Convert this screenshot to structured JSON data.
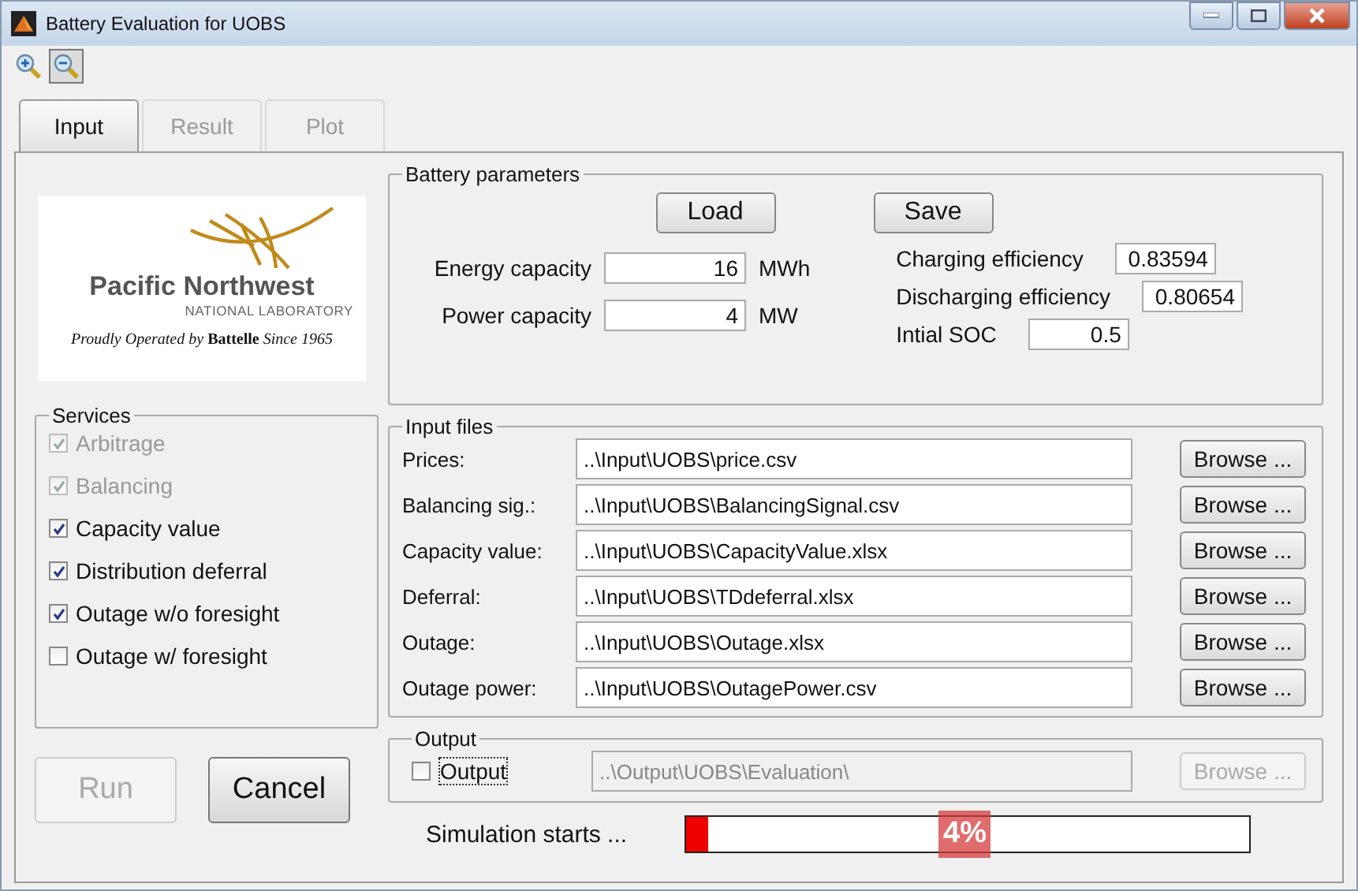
{
  "window": {
    "title": "Battery Evaluation for UOBS"
  },
  "toolbar": [
    {
      "kind": "zoom-in",
      "pressed": false
    },
    {
      "kind": "zoom-out",
      "pressed": true
    }
  ],
  "tabs": [
    {
      "label": "Input",
      "selected": true
    },
    {
      "label": "Result",
      "selected": false
    },
    {
      "label": "Plot",
      "selected": false
    }
  ],
  "logo": {
    "name": "Pacific Northwest",
    "subtitle": "NATIONAL LABORATORY",
    "tagline": "*Proudly Operated by* **Battelle** *Since 1965*"
  },
  "services": {
    "title": "Services",
    "items": [
      {
        "label": "Arbitrage",
        "checked": true,
        "disabled": true
      },
      {
        "label": "Balancing",
        "checked": true,
        "disabled": true
      },
      {
        "label": "Capacity value",
        "checked": true,
        "disabled": false
      },
      {
        "label": "Distribution deferral",
        "checked": true,
        "disabled": false
      },
      {
        "label": "Outage w/o foresight",
        "checked": true,
        "disabled": false
      },
      {
        "label": "Outage w/ foresight",
        "checked": false,
        "disabled": false
      }
    ]
  },
  "actions": [
    {
      "label": "Run",
      "disabled": true
    },
    {
      "label": "Cancel",
      "disabled": false
    }
  ],
  "battery_parameters": {
    "title": "Battery parameters",
    "buttons": [
      "Load",
      "Save"
    ],
    "left": [
      {
        "label": "Energy capacity",
        "value": "16",
        "unit": "MWh"
      },
      {
        "label": "Power capacity",
        "value": "4",
        "unit": "MW"
      }
    ],
    "right": [
      {
        "label": "Charging efficiency",
        "value": "0.83594"
      },
      {
        "label": "Discharging efficiency",
        "value": "0.80654"
      },
      {
        "label": "Intial SOC",
        "value": "0.5"
      }
    ]
  },
  "input_files": {
    "title": "Input files",
    "rows": [
      {
        "label": "Prices:",
        "path": "..\\Input\\UOBS\\price.csv",
        "button": "Browse ..."
      },
      {
        "label": "Balancing sig.:",
        "path": "..\\Input\\UOBS\\BalancingSignal.csv",
        "button": "Browse ..."
      },
      {
        "label": "Capacity value:",
        "path": "..\\Input\\UOBS\\CapacityValue.xlsx",
        "button": "Browse ..."
      },
      {
        "label": "Deferral:",
        "path": "..\\Input\\UOBS\\TDdeferral.xlsx",
        "button": "Browse ..."
      },
      {
        "label": "Outage:",
        "path": "..\\Input\\UOBS\\Outage.xlsx",
        "button": "Browse ..."
      },
      {
        "label": "Outage power:",
        "path": "..\\Input\\UOBS\\OutagePower.csv",
        "button": "Browse ..."
      }
    ]
  },
  "output": {
    "title": "Output",
    "checkbox": {
      "label": "Output",
      "checked": false,
      "focused": true
    },
    "path": "..\\Output\\UOBS\\Evaluation\\",
    "disabled": true,
    "button": "Browse ..."
  },
  "progress": {
    "label": "Simulation starts ...",
    "level": 0.04,
    "reading": "4%"
  }
}
